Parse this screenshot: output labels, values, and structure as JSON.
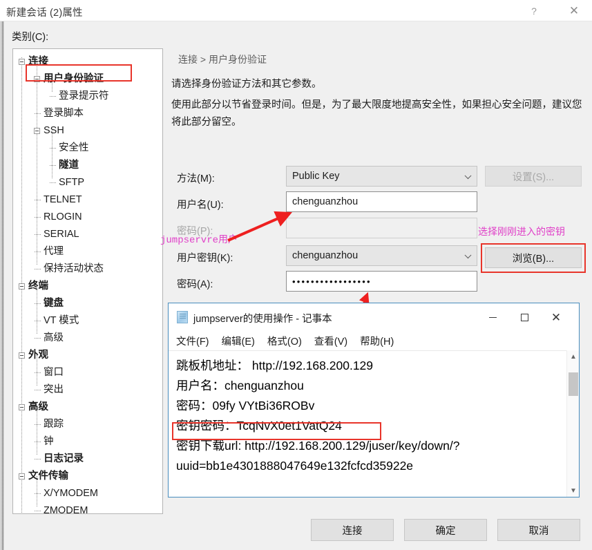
{
  "window": {
    "title": "新建会话 (2)属性",
    "help_icon": "?",
    "close_icon": "✕"
  },
  "category": {
    "label": "类别(C):",
    "tree": [
      {
        "label": "连接",
        "level": 0,
        "expander": true,
        "bold": true
      },
      {
        "label": "用户身份验证",
        "level": 1,
        "expander": true,
        "bold": true,
        "highlighted": true
      },
      {
        "label": "登录提示符",
        "level": 2,
        "expander": false,
        "bold": false
      },
      {
        "label": "登录脚本",
        "level": 1,
        "expander": false,
        "bold": false
      },
      {
        "label": "SSH",
        "level": 1,
        "expander": true,
        "bold": false
      },
      {
        "label": "安全性",
        "level": 2,
        "expander": false,
        "bold": false
      },
      {
        "label": "隧道",
        "level": 2,
        "expander": false,
        "bold": true
      },
      {
        "label": "SFTP",
        "level": 2,
        "expander": false,
        "bold": false
      },
      {
        "label": "TELNET",
        "level": 1,
        "expander": false,
        "bold": false
      },
      {
        "label": "RLOGIN",
        "level": 1,
        "expander": false,
        "bold": false
      },
      {
        "label": "SERIAL",
        "level": 1,
        "expander": false,
        "bold": false
      },
      {
        "label": "代理",
        "level": 1,
        "expander": false,
        "bold": false
      },
      {
        "label": "保持活动状态",
        "level": 1,
        "expander": false,
        "bold": false
      },
      {
        "label": "终端",
        "level": 0,
        "expander": true,
        "bold": true
      },
      {
        "label": "键盘",
        "level": 1,
        "expander": false,
        "bold": true
      },
      {
        "label": "VT 模式",
        "level": 1,
        "expander": false,
        "bold": false
      },
      {
        "label": "高级",
        "level": 1,
        "expander": false,
        "bold": false
      },
      {
        "label": "外观",
        "level": 0,
        "expander": true,
        "bold": true
      },
      {
        "label": "窗口",
        "level": 1,
        "expander": false,
        "bold": false
      },
      {
        "label": "突出",
        "level": 1,
        "expander": false,
        "bold": false
      },
      {
        "label": "高级",
        "level": 0,
        "expander": true,
        "bold": true
      },
      {
        "label": "跟踪",
        "level": 1,
        "expander": false,
        "bold": false
      },
      {
        "label": "钟",
        "level": 1,
        "expander": false,
        "bold": false
      },
      {
        "label": "日志记录",
        "level": 1,
        "expander": false,
        "bold": true
      },
      {
        "label": "文件传输",
        "level": 0,
        "expander": true,
        "bold": true
      },
      {
        "label": "X/YMODEM",
        "level": 1,
        "expander": false,
        "bold": false
      },
      {
        "label": "ZMODEM",
        "level": 1,
        "expander": false,
        "bold": false
      }
    ]
  },
  "panel": {
    "breadcrumb": "连接 > 用户身份验证",
    "description_1": "请选择身份验证方法和其它参数。",
    "description_2": "使用此部分以节省登录时间。但是，为了最大限度地提高安全性，如果担心安全问题，建议您将此部分留空。",
    "fields": {
      "method_label": "方法(M):",
      "method_value": "Public Key",
      "settings_button": "设置(S)...",
      "username_label": "用户名(U):",
      "username_value": "chenguanzhou",
      "password_label": "密码(P):",
      "password_value": "",
      "userkey_label": "用户密钥(K):",
      "userkey_value": "chenguanzhou",
      "browse_button": "浏览(B)...",
      "passphrase_label": "密码(A):",
      "passphrase_value": "•••••••••••••••••"
    }
  },
  "annotations": {
    "left_note": "jumpservre用户",
    "right_note": "选择刚刚进入的密钥",
    "accent_color": "#e040c8",
    "highlight_color": "#e8342a",
    "arrow_color": "#ee2020"
  },
  "notepad": {
    "title": "jumpserver的使用操作 - 记事本",
    "icon": "notepad-icon",
    "controls": {
      "minimize": "minimize-icon",
      "maximize": "maximize-icon",
      "close": "close-icon"
    },
    "menu": [
      "文件(F)",
      "编辑(E)",
      "格式(O)",
      "查看(V)",
      "帮助(H)"
    ],
    "lines": [
      "跳板机地址： http://192.168.200.129",
      "用户名：chenguanzhou",
      "密码：09fy VYtBi36ROBv",
      "密钥密码：TcqNvX0et1VatQ24",
      "密钥下载url: http://192.168.200.129/juser/key/down/?",
      "uuid=bb1e4301888047649e132fcfcd35922e"
    ],
    "scrollbar": {
      "up": "▲",
      "down": "▼"
    }
  },
  "footer": {
    "connect": "连接",
    "ok": "确定",
    "cancel": "取消"
  }
}
